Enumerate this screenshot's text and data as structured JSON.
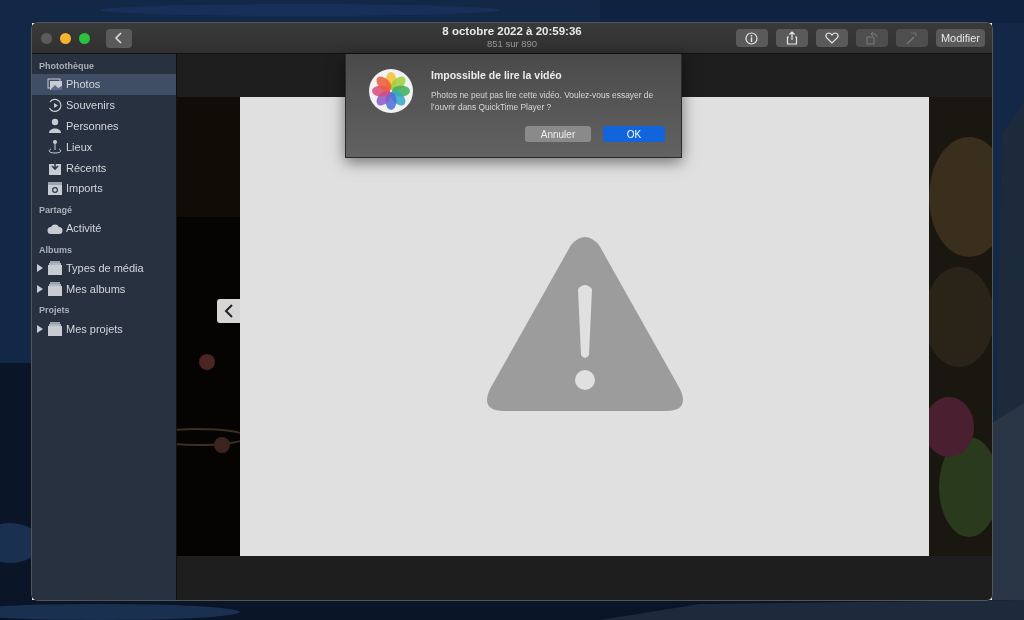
{
  "window": {
    "title": "8 octobre 2022 à 20:59:36",
    "subtitle": "851 sur 890"
  },
  "toolbar": {
    "buttons": [
      {
        "kind": "info",
        "disabled": false
      },
      {
        "kind": "share",
        "disabled": false
      },
      {
        "kind": "favorite",
        "disabled": false
      },
      {
        "kind": "rotate",
        "disabled": true
      },
      {
        "kind": "enhance",
        "disabled": true
      },
      {
        "kind": "text",
        "label": "Modifier",
        "disabled": false
      }
    ]
  },
  "sidebar": {
    "sections": [
      {
        "title": "Photothèque",
        "items": [
          {
            "label": "Photos",
            "selected": true
          },
          {
            "label": "Souvenirs",
            "selected": false
          },
          {
            "label": "Personnes",
            "selected": false
          },
          {
            "label": "Lieux",
            "selected": false
          },
          {
            "label": "Récents",
            "selected": false
          },
          {
            "label": "Imports",
            "selected": false
          }
        ]
      },
      {
        "title": "Partagé",
        "items": [
          {
            "label": "Activité",
            "selected": false
          }
        ]
      },
      {
        "title": "Albums",
        "items": [
          {
            "label": "Types de média",
            "selected": false,
            "expanded": false
          },
          {
            "label": "Mes albums",
            "selected": false,
            "expanded": false
          }
        ]
      },
      {
        "title": "Projets",
        "items": [
          {
            "label": "Mes projets",
            "selected": false,
            "expanded": false
          }
        ]
      }
    ]
  },
  "dialog": {
    "title": "Impossible de lire la vidéo",
    "message": "Photos ne peut pas lire cette vidéo. Voulez-vous essayer de l’ouvrir dans QuickTime Player ?",
    "buttons": [
      {
        "label": "Annuler",
        "default": false
      },
      {
        "label": "OK",
        "default": true
      }
    ]
  }
}
